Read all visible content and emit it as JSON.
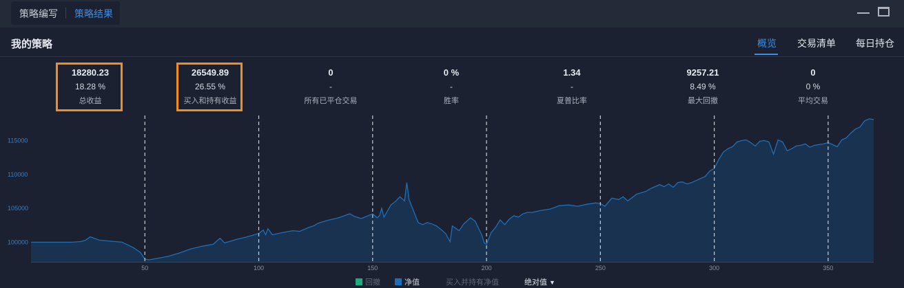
{
  "top_tabs": [
    "策略编写",
    "策略结果"
  ],
  "page_title": "我的策略",
  "right_tabs": [
    "概览",
    "交易清单",
    "每日持仓"
  ],
  "metrics": [
    {
      "value": "18280.23",
      "sub": "18.28 %",
      "label": "总收益"
    },
    {
      "value": "26549.89",
      "sub": "26.55 %",
      "label": "买入和持有收益"
    },
    {
      "value": "0",
      "sub": "-",
      "label": "所有已平仓交易"
    },
    {
      "value": "0 %",
      "sub": "-",
      "label": "胜率"
    },
    {
      "value": "1.34",
      "sub": "-",
      "label": "夏普比率"
    },
    {
      "value": "9257.21",
      "sub": "8.49 %",
      "label": "最大回撤"
    },
    {
      "value": "0",
      "sub": "0 %",
      "label": "平均交易"
    }
  ],
  "legend": {
    "drawdown": "回撤",
    "net_value": "净值",
    "buy_hold": "买入并持有净值",
    "mode": "绝对值"
  },
  "colors": {
    "accent": "#3a8ee6",
    "highlight": "#f08f1c",
    "line": "#1f6fb8",
    "fill": "#18324f",
    "drawdown": "#1aaf7a"
  },
  "chart_data": {
    "type": "area",
    "x_ticks": [
      50,
      100,
      150,
      200,
      250,
      300,
      350
    ],
    "y_ticks": [
      100000,
      105000,
      110000,
      115000
    ],
    "xlim": [
      0,
      370
    ],
    "ylim": [
      97100,
      118700
    ],
    "grid": "vertical dashed lines at x ticks",
    "series": [
      {
        "name": "净值",
        "x": [
          0,
          10,
          18,
          22,
          24,
          26,
          30,
          40,
          45,
          48,
          50,
          52,
          55,
          60,
          65,
          70,
          75,
          80,
          83,
          85,
          90,
          95,
          100,
          102,
          103,
          104,
          106,
          110,
          115,
          118,
          120,
          122,
          124,
          126,
          130,
          135,
          140,
          142,
          145,
          148,
          150,
          152,
          153,
          154,
          155,
          158,
          160,
          162,
          164,
          165,
          166,
          168,
          170,
          172,
          174,
          176,
          178,
          180,
          182,
          184,
          185,
          188,
          190,
          193,
          195,
          197,
          198,
          199,
          200,
          202,
          204,
          206,
          208,
          210,
          212,
          214,
          216,
          218,
          220,
          224,
          228,
          232,
          236,
          240,
          244,
          248,
          250,
          252,
          255,
          258,
          260,
          262,
          264,
          266,
          268,
          270,
          272,
          274,
          276,
          278,
          280,
          282,
          284,
          286,
          288,
          290,
          292,
          294,
          296,
          298,
          300,
          302,
          304,
          306,
          308,
          310,
          312,
          314,
          316,
          318,
          320,
          322,
          324,
          326,
          328,
          330,
          332,
          334,
          336,
          338,
          340,
          342,
          344,
          346,
          348,
          350,
          352,
          354,
          356,
          358,
          360,
          362,
          364,
          366,
          368,
          370
        ],
        "y": [
          100000,
          100000,
          100000,
          100100,
          100300,
          100800,
          100300,
          100000,
          99200,
          98500,
          97500,
          97400,
          97600,
          97900,
          98400,
          99000,
          99400,
          99700,
          100600,
          99900,
          100400,
          100800,
          101300,
          101800,
          101100,
          102000,
          101100,
          101400,
          101700,
          101600,
          101900,
          102200,
          102400,
          102800,
          103200,
          103600,
          104200,
          103800,
          103500,
          103900,
          104200,
          103600,
          103900,
          105000,
          103700,
          105500,
          106000,
          106700,
          106100,
          108800,
          106300,
          104600,
          102900,
          102600,
          102900,
          102700,
          102400,
          101900,
          101300,
          100100,
          102400,
          101700,
          102700,
          103600,
          103100,
          101700,
          101000,
          99900,
          99700,
          101400,
          102200,
          103300,
          102600,
          103400,
          103900,
          103700,
          104200,
          104400,
          104400,
          104700,
          104900,
          105400,
          105500,
          105300,
          105600,
          105800,
          105700,
          105300,
          106500,
          106300,
          106700,
          106100,
          106600,
          107100,
          107300,
          107500,
          107900,
          108200,
          108500,
          108200,
          108600,
          108100,
          108800,
          108900,
          108600,
          108800,
          109100,
          109400,
          109700,
          110500,
          110900,
          112200,
          113300,
          113800,
          114100,
          114800,
          115000,
          115100,
          114700,
          114200,
          114900,
          115000,
          114800,
          113000,
          115100,
          114800,
          113500,
          113800,
          114200,
          114300,
          114500,
          114000,
          114300,
          114400,
          114500,
          114700,
          114400,
          114100,
          115100,
          115400,
          116100,
          116700,
          117000,
          117900,
          118200,
          118100
        ]
      }
    ]
  }
}
